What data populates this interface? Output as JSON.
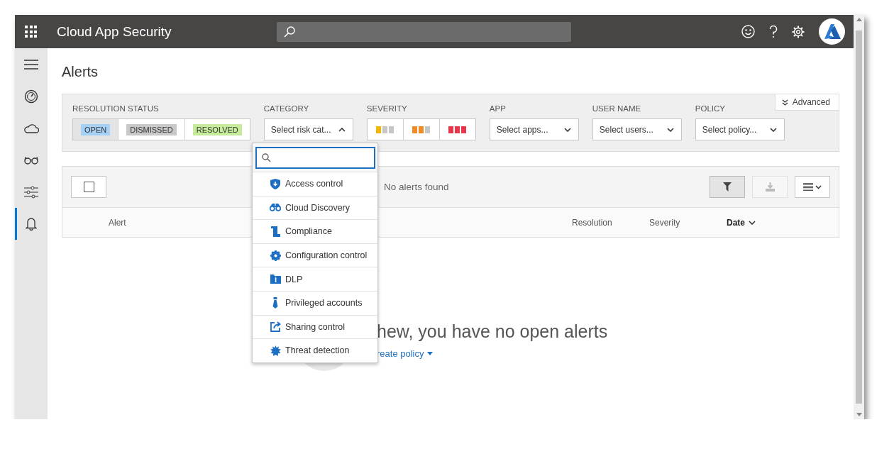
{
  "header": {
    "title": "Cloud App Security"
  },
  "sidebar": {
    "items": [
      {
        "kind": "menu",
        "selected": false
      },
      {
        "kind": "dashboard",
        "selected": false
      },
      {
        "kind": "cloud",
        "selected": false
      },
      {
        "kind": "glasses",
        "selected": false
      },
      {
        "kind": "sliders",
        "selected": false
      },
      {
        "kind": "bell",
        "selected": true
      }
    ]
  },
  "page_title": "Alerts",
  "filters": {
    "advanced": "Advanced",
    "resolution_status": {
      "label": "RESOLUTION STATUS",
      "options": [
        {
          "label": "OPEN",
          "selected": true,
          "color": "#a6d1f7"
        },
        {
          "label": "DISMISSED",
          "selected": false,
          "color": "#c8c8c8"
        },
        {
          "label": "RESOLVED",
          "selected": false,
          "color": "#c5eb9b"
        }
      ]
    },
    "category": {
      "label": "CATEGORY",
      "value": "Select risk cat...",
      "expanded": true
    },
    "severity": {
      "label": "SEVERITY",
      "options": [
        {
          "kind": "low",
          "color": "#f2b705"
        },
        {
          "kind": "medium",
          "color": "#f08a24"
        },
        {
          "kind": "high",
          "color": "#e8364a"
        }
      ]
    },
    "selects": [
      {
        "label": "APP",
        "value": "Select apps..."
      },
      {
        "label": "USER NAME",
        "value": "Select users..."
      },
      {
        "label": "POLICY",
        "value": "Select policy..."
      }
    ]
  },
  "category_menu": {
    "items": [
      {
        "kind": "shield",
        "label": "Access control"
      },
      {
        "kind": "binoculars",
        "label": "Cloud Discovery"
      },
      {
        "kind": "scroll",
        "label": "Compliance"
      },
      {
        "kind": "gear",
        "label": "Configuration control"
      },
      {
        "kind": "folder",
        "label": "DLP"
      },
      {
        "kind": "tie",
        "label": "Privileged accounts"
      },
      {
        "kind": "share",
        "label": "Sharing control"
      },
      {
        "kind": "burst",
        "label": "Threat detection"
      }
    ]
  },
  "table": {
    "select_all_checked": false,
    "status": "No alerts found",
    "tools": [
      {
        "kind": "filter",
        "pressed": true,
        "disabled": false
      },
      {
        "kind": "download",
        "pressed": false,
        "disabled": true
      },
      {
        "kind": "columns",
        "pressed": false,
        "disabled": false
      }
    ],
    "columns": [
      {
        "label": "Alert",
        "sorted": false
      },
      {
        "label": "Resolution",
        "sorted": false
      },
      {
        "label": "Severity",
        "sorted": false
      },
      {
        "label": "Date",
        "sorted": true
      }
    ]
  },
  "empty_state": {
    "message": "hew, you have no open alerts",
    "link": "reate policy"
  }
}
